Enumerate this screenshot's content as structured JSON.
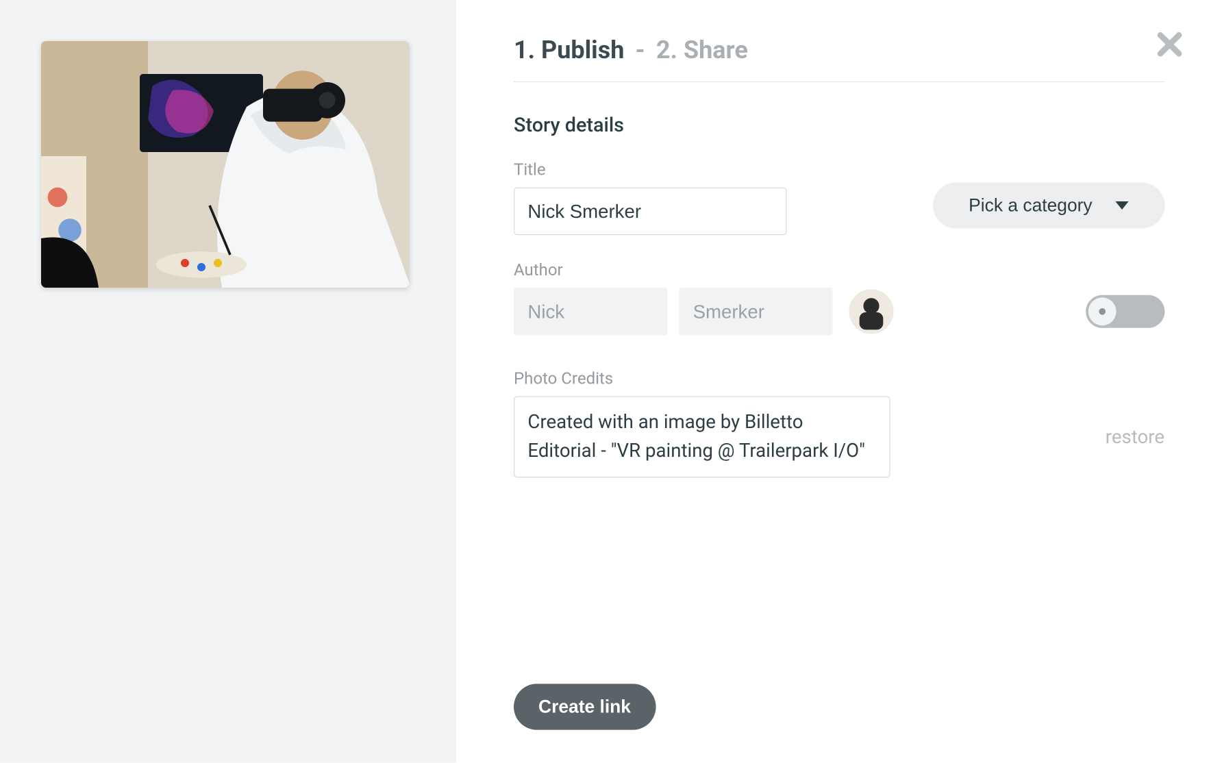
{
  "steps": {
    "current_label": "1. Publish",
    "separator": "-",
    "next_label": "2. Share"
  },
  "close_icon_name": "close-icon",
  "section_heading": "Story details",
  "title": {
    "label": "Title",
    "value": "Nick Smerker"
  },
  "category": {
    "placeholder": "Pick a category"
  },
  "author": {
    "label": "Author",
    "first_name": "Nick",
    "last_name": "Smerker"
  },
  "toggle": {
    "state": "off"
  },
  "credits": {
    "label": "Photo Credits",
    "value": "Created with an image by Billetto Editorial - \"VR painting @ Trailerpark I/O\"",
    "restore_label": "restore"
  },
  "footer": {
    "create_label": "Create link"
  }
}
